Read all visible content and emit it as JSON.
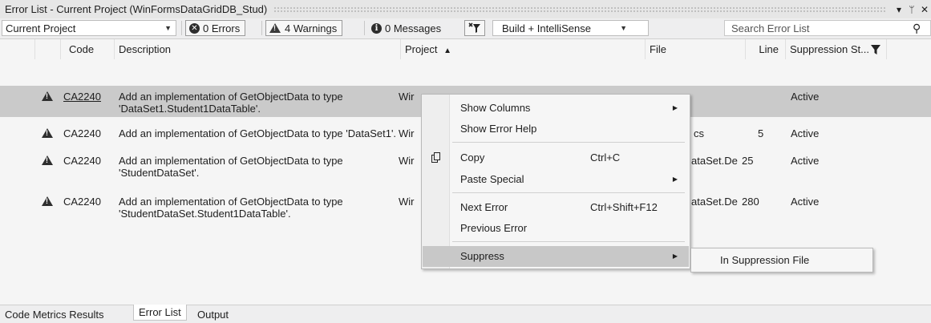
{
  "window": {
    "title": "Error List - Current Project (WinFormsDataGridDB_Stud)",
    "controls": {
      "dropdown": "▾",
      "pin": "ᛘ",
      "close": "✕"
    }
  },
  "toolbar": {
    "scope": "Current Project",
    "errors": "0 Errors",
    "warnings": "4 Warnings",
    "messages": "0 Messages",
    "build_filter": "Build + IntelliSense",
    "search_placeholder": "Search Error List"
  },
  "columns": [
    "Code",
    "Description",
    "Project",
    "File",
    "Line",
    "Suppression St..."
  ],
  "sort_indicator": "▲",
  "rows": [
    {
      "code": "CA2240",
      "desc": "Add an implementation of GetObjectData to type 'DataSet1.Student1DataTable'.",
      "project": "Wir",
      "file": "",
      "line": "",
      "suppression": "Active",
      "selected": true
    },
    {
      "code": "CA2240",
      "desc": "Add an implementation of GetObjectData to type 'DataSet1'.",
      "project": "Wir",
      "file": "cs",
      "line": "5",
      "suppression": "Active",
      "selected": false
    },
    {
      "code": "CA2240",
      "desc": "Add an implementation of GetObjectData to type 'StudentDataSet'.",
      "project": "Wir",
      "file": "ataSet.De",
      "line": "25",
      "suppression": "Active",
      "selected": false
    },
    {
      "code": "CA2240",
      "desc": "Add an implementation of GetObjectData to type 'StudentDataSet.Student1DataTable'.",
      "project": "Wir",
      "file": "ataSet.De",
      "line": "280",
      "suppression": "Active",
      "selected": false
    }
  ],
  "context_menu": {
    "items": [
      {
        "label": "Show Columns",
        "shortcut": "",
        "submenu": true
      },
      {
        "label": "Show Error Help",
        "shortcut": "",
        "submenu": false
      },
      {
        "label": "Copy",
        "shortcut": "Ctrl+C",
        "submenu": false
      },
      {
        "label": "Paste Special",
        "shortcut": "",
        "submenu": true
      },
      {
        "label": "Next Error",
        "shortcut": "Ctrl+Shift+F12",
        "submenu": false
      },
      {
        "label": "Previous Error",
        "shortcut": "",
        "submenu": false
      },
      {
        "label": "Suppress",
        "shortcut": "",
        "submenu": true
      }
    ],
    "submenu_item": "In Suppression File"
  },
  "tabs": [
    "Code Metrics Results",
    "Error List",
    "Output"
  ],
  "active_tab": "Error List",
  "colors": {
    "selected_row": "#cacaca",
    "menu_highlight": "#c8c8c8",
    "panel_bg": "#f5f5f5"
  }
}
